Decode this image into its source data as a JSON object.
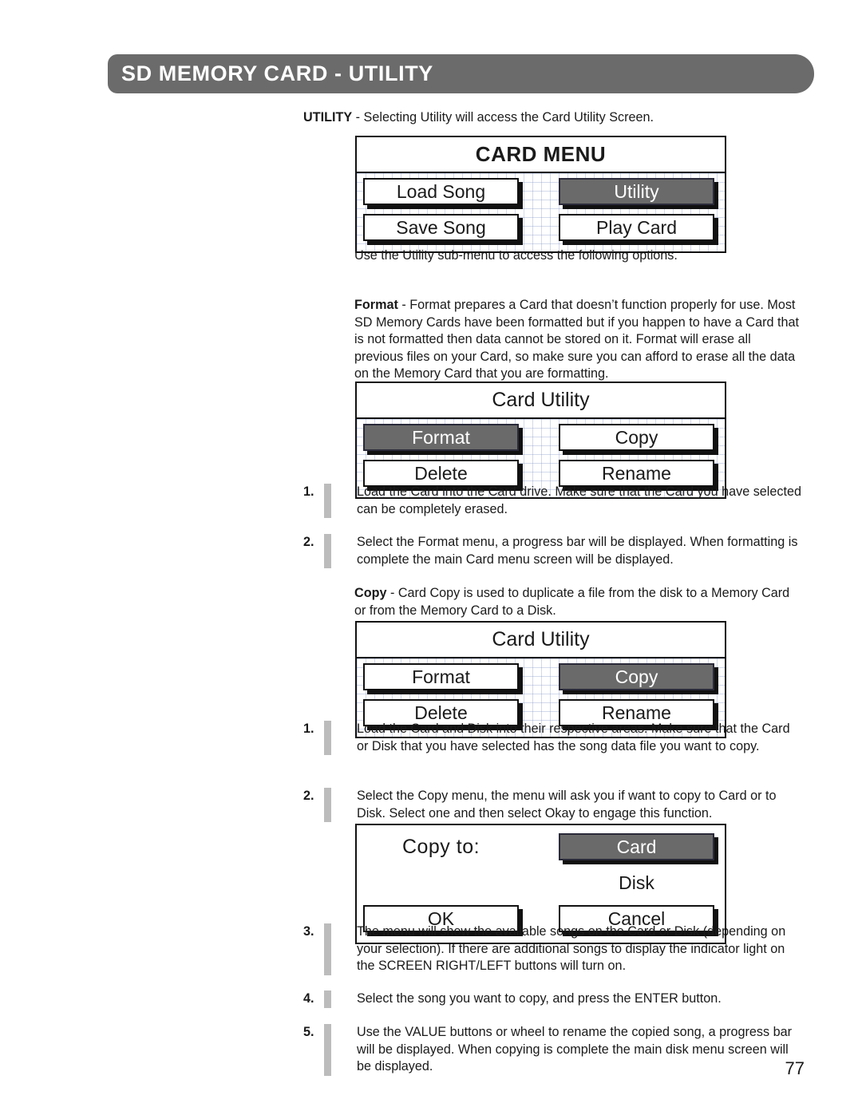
{
  "header": {
    "title": "SD MEMORY CARD - UTILITY"
  },
  "intro": {
    "label": "UTILITY",
    "text": " - Selecting Utility will access the Card Utility Screen."
  },
  "card_menu_panel": {
    "title": "CARD MENU",
    "buttons": [
      {
        "label": "Load Song",
        "selected": false
      },
      {
        "label": "Utility",
        "selected": true
      },
      {
        "label": "Save Song",
        "selected": false
      },
      {
        "label": "Play Card",
        "selected": false
      }
    ]
  },
  "submenu_note": "Use the Utility sub-menu to access the following options.",
  "format_section": {
    "label": "Format",
    "text": " - Format prepares a Card that doesn’t function properly for use. Most SD Memory Cards have been formatted but if you happen to have a Card that is not formatted then data cannot be stored on it.   Format will erase all previous files on your Card, so make sure you can afford to erase all the data on the Memory Card that you are formatting."
  },
  "card_utility_format_panel": {
    "title": "Card Utility",
    "buttons": [
      {
        "label": "Format",
        "selected": true
      },
      {
        "label": "Copy",
        "selected": false
      },
      {
        "label": "Delete",
        "selected": false
      },
      {
        "label": "Rename",
        "selected": false
      }
    ]
  },
  "format_steps": [
    {
      "number": "1.",
      "text": "Load the Card into the Card drive.  Make sure that the Card you have selected can be completely erased."
    },
    {
      "number": "2.",
      "text": "Select the Format menu, a progress bar will be displayed.  When formatting is complete the main Card menu screen will be displayed."
    }
  ],
  "copy_section": {
    "label": "Copy",
    "text": " - Card Copy is used to duplicate a file from the disk to a Memory Card or from the Memory Card to a Disk."
  },
  "card_utility_copy_panel": {
    "title": "Card Utility",
    "buttons": [
      {
        "label": "Format",
        "selected": false
      },
      {
        "label": "Copy",
        "selected": true
      },
      {
        "label": "Delete",
        "selected": false
      },
      {
        "label": "Rename",
        "selected": false
      }
    ]
  },
  "copy_steps_top": [
    {
      "number": "1.",
      "text": "Load the Card and Disk into their respective areas.  Make sure that the Card or Disk that you have selected has the song data file you want to copy."
    },
    {
      "number": "2.",
      "text": "Select the Copy menu, the menu will ask you if want to copy to Card or to Disk. Select one and then select Okay to engage this function."
    }
  ],
  "copy_to_panel": {
    "prompt": "Copy to:",
    "destination_card": "Card",
    "destination_disk": "Disk",
    "ok_label": "OK",
    "cancel_label": "Cancel"
  },
  "copy_steps_bottom": [
    {
      "number": "3.",
      "text": "The menu will show the available songs on the Card or Disk (depending on your selection).  If there are additional songs to display the indicator light on the SCREEN RIGHT/LEFT buttons will turn on."
    },
    {
      "number": "4.",
      "text": "Select the song you want to copy, and press the ENTER button."
    },
    {
      "number": "5.",
      "text": "Use the VALUE buttons or wheel to rename the copied song, a progress bar will be displayed.  When copying is complete the main disk menu screen will be displayed."
    }
  ],
  "page_number": "77",
  "colors": {
    "header_gray": "#6b6b6b",
    "selected_button_gray": "#6a6a6a",
    "step_bar_gray": "#bcbcbc",
    "grid_blue": "#7a8cbe"
  }
}
